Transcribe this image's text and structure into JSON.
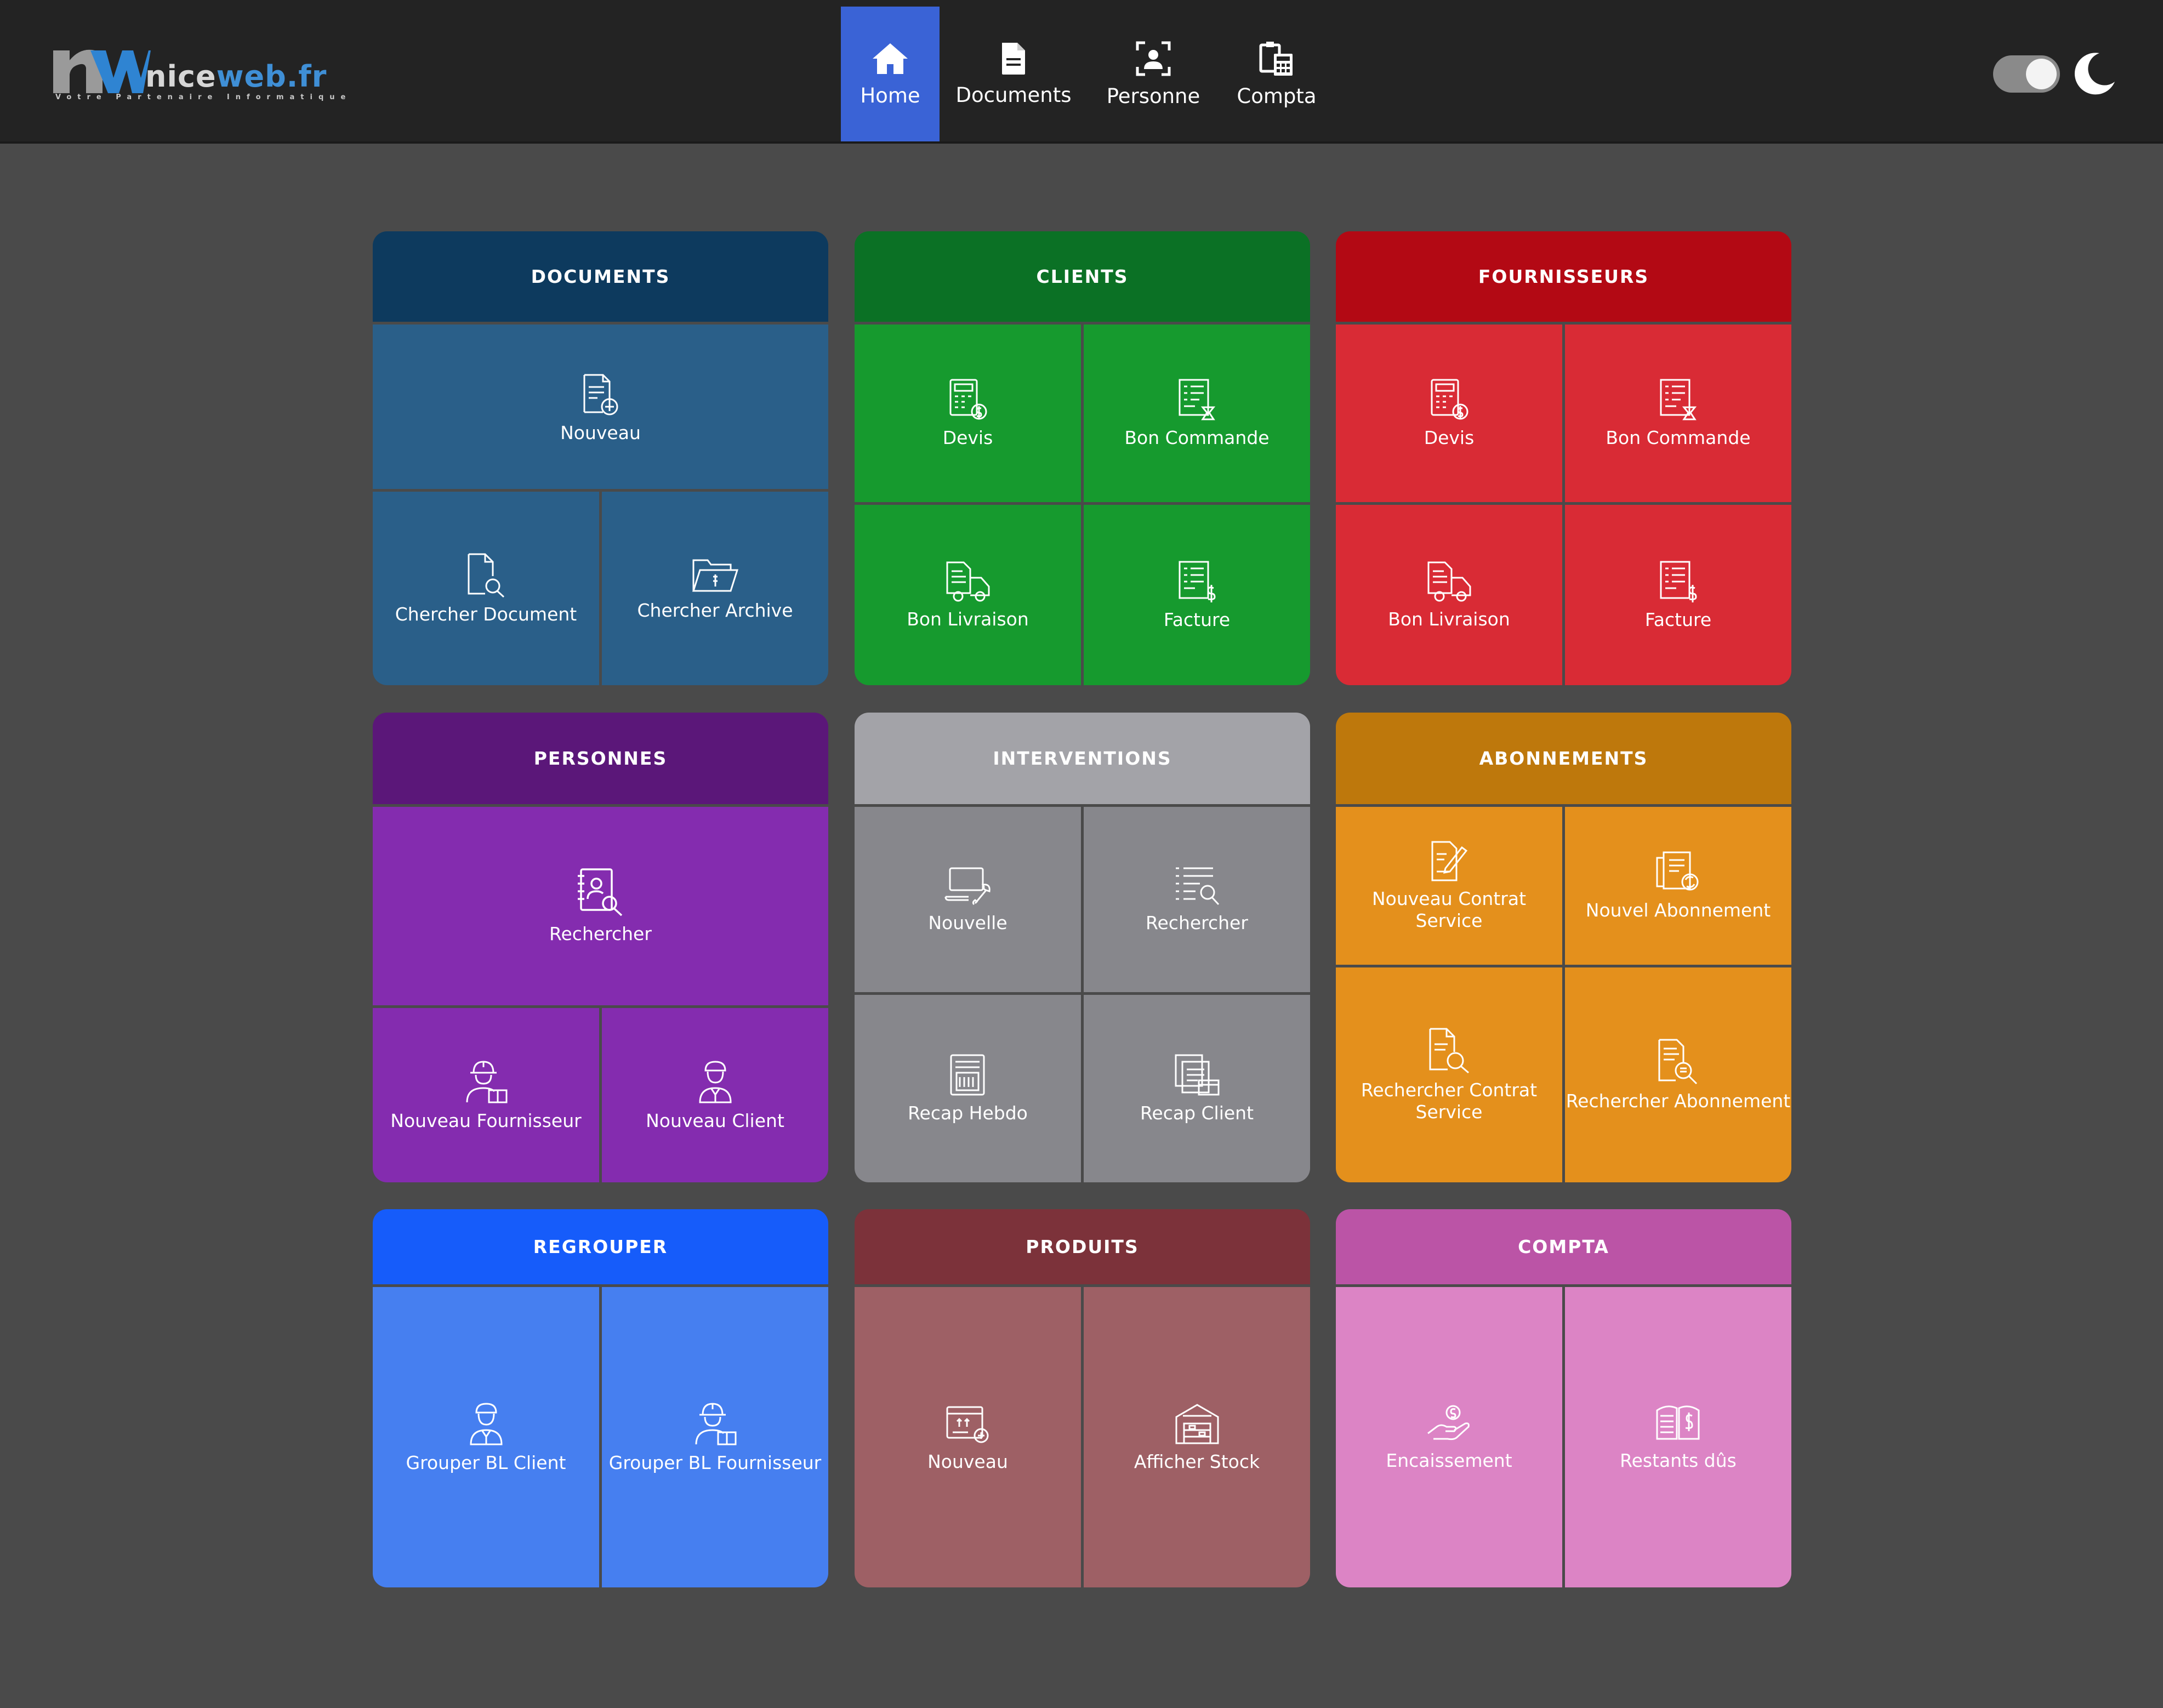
{
  "logo": {
    "brand_a": "nice",
    "brand_b": "web.fr",
    "tagline": "Votre Partenaire Informatique"
  },
  "nav": [
    {
      "label": "Home",
      "icon": "home-icon",
      "active": true
    },
    {
      "label": "Documents",
      "icon": "document-icon",
      "active": false
    },
    {
      "label": "Personne",
      "icon": "person-icon",
      "active": false
    },
    {
      "label": "Compta",
      "icon": "calculator-icon",
      "active": false
    }
  ],
  "theme": {
    "dark_mode": true,
    "icon": "moon-icon"
  },
  "colors": {
    "documents": "#0d3a5e",
    "documents_tile": "#2a5f89",
    "clients": "#0b7125",
    "clients_tile": "#169a2e",
    "fournisseurs": "#b30914",
    "fournisseurs_tile": "#d92b35",
    "personnes": "#5b1779",
    "personnes_tile": "#842caf",
    "interventions": "#a3a3a8",
    "interventions_tile": "#87878c",
    "abonnements": "#be780c",
    "abonnements_tile": "#e4901c",
    "regrouper": "#165cfa",
    "regrouper_tile": "#467ff0",
    "produits": "#7c323a",
    "produits_tile": "#9e6065",
    "compta": "#bb54a6",
    "compta_tile": "#dc84c5"
  },
  "cards": {
    "documents": {
      "title": "DOCUMENTS",
      "tiles": [
        "Nouveau",
        "Chercher Document",
        "Chercher Archive"
      ]
    },
    "clients": {
      "title": "CLIENTS",
      "tiles": [
        "Devis",
        "Bon Commande",
        "Bon Livraison",
        "Facture"
      ]
    },
    "fournisseurs": {
      "title": "FOURNISSEURS",
      "tiles": [
        "Devis",
        "Bon Commande",
        "Bon Livraison",
        "Facture"
      ]
    },
    "personnes": {
      "title": "PERSONNES",
      "tiles": [
        "Rechercher",
        "Nouveau Fournisseur",
        "Nouveau Client"
      ]
    },
    "interventions": {
      "title": "INTERVENTIONS",
      "tiles": [
        "Nouvelle",
        "Rechercher",
        "Recap Hebdo",
        "Recap Client"
      ]
    },
    "abonnements": {
      "title": "ABONNEMENTS",
      "tiles": [
        "Nouveau Contrat Service",
        "Nouvel Abonnement",
        "Rechercher Contrat Service",
        "Rechercher Abonnement"
      ]
    },
    "regrouper": {
      "title": "REGROUPER",
      "tiles": [
        "Grouper BL Client",
        "Grouper BL Fournisseur"
      ]
    },
    "produits": {
      "title": "PRODUITS",
      "tiles": [
        "Nouveau",
        "Afficher Stock"
      ]
    },
    "compta": {
      "title": "COMPTA",
      "tiles": [
        "Encaissement",
        "Restants dûs"
      ]
    }
  }
}
